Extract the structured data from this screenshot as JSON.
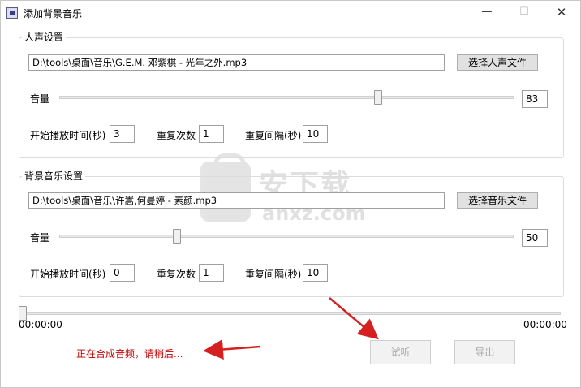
{
  "window": {
    "title": "添加背景音乐",
    "minimize_glyph": "—",
    "maximize_glyph": "☐",
    "close_glyph": "✕"
  },
  "voice": {
    "group_title": "人声设置",
    "file_path": "D:\\tools\\桌面\\音乐\\G.E.M. 邓紫棋 - 光年之外.mp3",
    "choose_button": "选择人声文件",
    "volume_label": "音量",
    "volume_value": "83",
    "volume_level": 83,
    "start_time_label": "开始播放时间(秒)",
    "start_time_value": "3",
    "repeat_count_label": "重复次数",
    "repeat_count_value": "1",
    "repeat_interval_label": "重复间隔(秒)",
    "repeat_interval_value": "10"
  },
  "bgm": {
    "group_title": "背景音乐设置",
    "file_path": "D:\\tools\\桌面\\音乐\\许嵩,何曼婷 - 素颜.mp3",
    "choose_button": "选择音乐文件",
    "volume_label": "音量",
    "volume_value": "50",
    "volume_level": 50,
    "start_time_label": "开始播放时间(秒)",
    "start_time_value": "0",
    "repeat_count_label": "重复次数",
    "repeat_count_value": "1",
    "repeat_interval_label": "重复间隔(秒)",
    "repeat_interval_value": "10"
  },
  "playback": {
    "current_time": "00:00:00",
    "total_time": "00:00:00",
    "progress": 0
  },
  "status_text": "正在合成音频，请稍后...",
  "actions": {
    "preview_button": "试听",
    "export_button": "导出"
  },
  "watermark": {
    "text": "安下载",
    "sub": "anxz.com"
  },
  "colors": {
    "status": "#c00000",
    "arrow": "#d42020"
  }
}
